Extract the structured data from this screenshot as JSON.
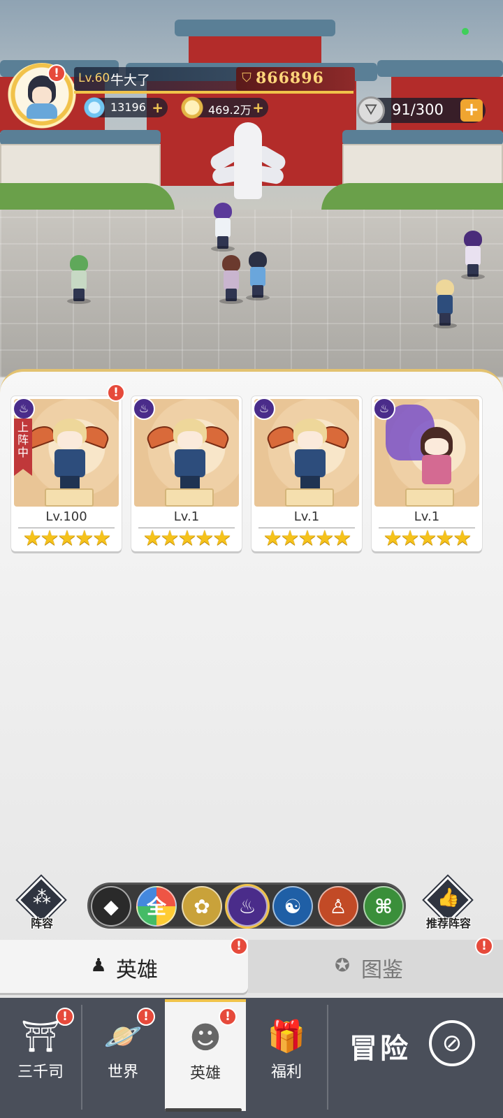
{
  "player": {
    "level": "Lv.60",
    "name": "牛大了",
    "power": "866896"
  },
  "resources": {
    "diamonds": "13196",
    "gold": "469.2万",
    "stamina": "91/300"
  },
  "hero_cards": [
    {
      "level": "Lv.100",
      "stars": 5,
      "in_lineup_label": "上阵中"
    },
    {
      "level": "Lv.1",
      "stars": 5
    },
    {
      "level": "Lv.1",
      "stars": 5
    },
    {
      "level": "Lv.1",
      "stars": 5
    }
  ],
  "filters": {
    "lineup_label": "阵容",
    "recommend_label": "推荐阵容",
    "all_label": "全",
    "active": "dark-element"
  },
  "tabs": {
    "heroes": "英雄",
    "atlas": "图鉴"
  },
  "bottom_nav": {
    "sanqiansi": "三千司",
    "world": "世界",
    "heroes": "英雄",
    "welfare": "福利",
    "adventure": "冒险"
  },
  "alert_mark": "!",
  "colors": {
    "accent_gold": "#f0c34a",
    "alert_red": "#e64a3b",
    "nav_bg": "#4a4f5a"
  }
}
